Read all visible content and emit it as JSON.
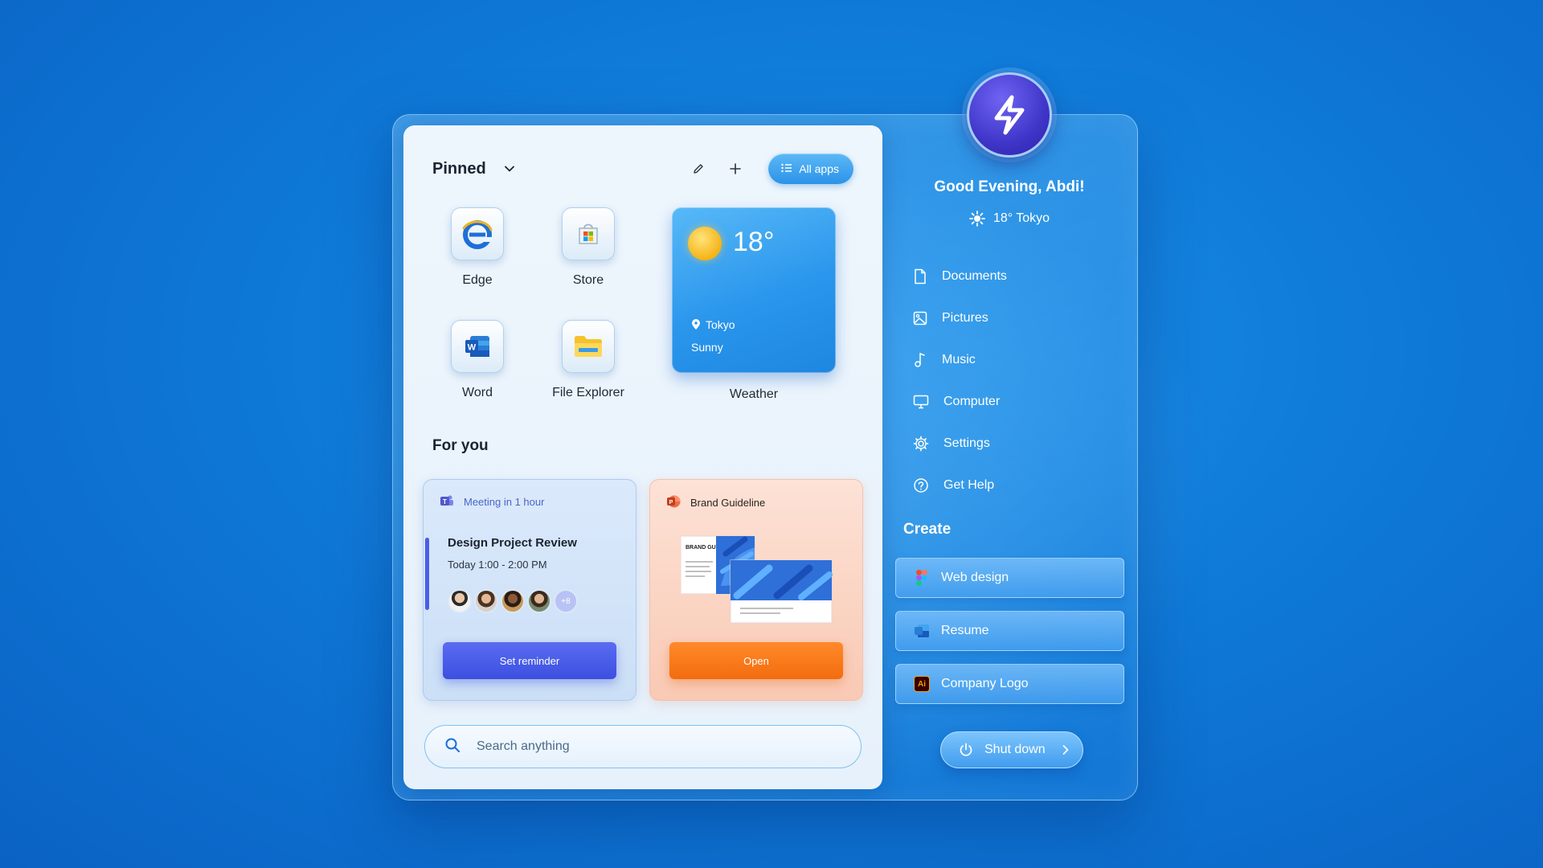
{
  "pinned": {
    "title": "Pinned",
    "all_apps_label": "All apps",
    "apps": [
      {
        "label": "Edge",
        "icon": "edge-icon"
      },
      {
        "label": "Store",
        "icon": "store-icon"
      },
      {
        "label": "Word",
        "icon": "word-icon"
      },
      {
        "label": "File Explorer",
        "icon": "file-explorer-icon"
      }
    ],
    "weather": {
      "temp": "18°",
      "city": "Tokyo",
      "condition": "Sunny",
      "label": "Weather"
    }
  },
  "for_you": {
    "title": "For you",
    "meeting": {
      "badge": "Meeting in 1 hour",
      "title": "Design Project Review",
      "time": "Today 1:00 - 2:00 PM",
      "more_attendees": "+8",
      "button": "Set reminder"
    },
    "brand": {
      "title": "Brand Guideline",
      "preview_heading": "BRAND GUIDELINE",
      "button": "Open"
    }
  },
  "search": {
    "placeholder": "Search anything"
  },
  "profile": {
    "greeting": "Good Evening, Abdi!",
    "weather": "18° Tokyo"
  },
  "nav": [
    {
      "label": "Documents",
      "icon": "document-icon"
    },
    {
      "label": "Pictures",
      "icon": "picture-icon"
    },
    {
      "label": "Music",
      "icon": "music-icon"
    },
    {
      "label": "Computer",
      "icon": "monitor-icon"
    },
    {
      "label": "Settings",
      "icon": "gear-icon"
    },
    {
      "label": "Get Help",
      "icon": "help-icon"
    }
  ],
  "create": {
    "title": "Create",
    "items": [
      {
        "label": "Web design",
        "icon": "figma-icon"
      },
      {
        "label": "Resume",
        "icon": "word-icon"
      },
      {
        "label": "Company Logo",
        "icon": "illustrator-icon",
        "badge": "Ai"
      }
    ]
  },
  "power": {
    "label": "Shut down"
  },
  "colors": {
    "accent_blue": "#2b93e8",
    "reminder_button": "#4a5ee8",
    "open_button": "#f36c0e",
    "logo_purple": "#3f36c9"
  }
}
